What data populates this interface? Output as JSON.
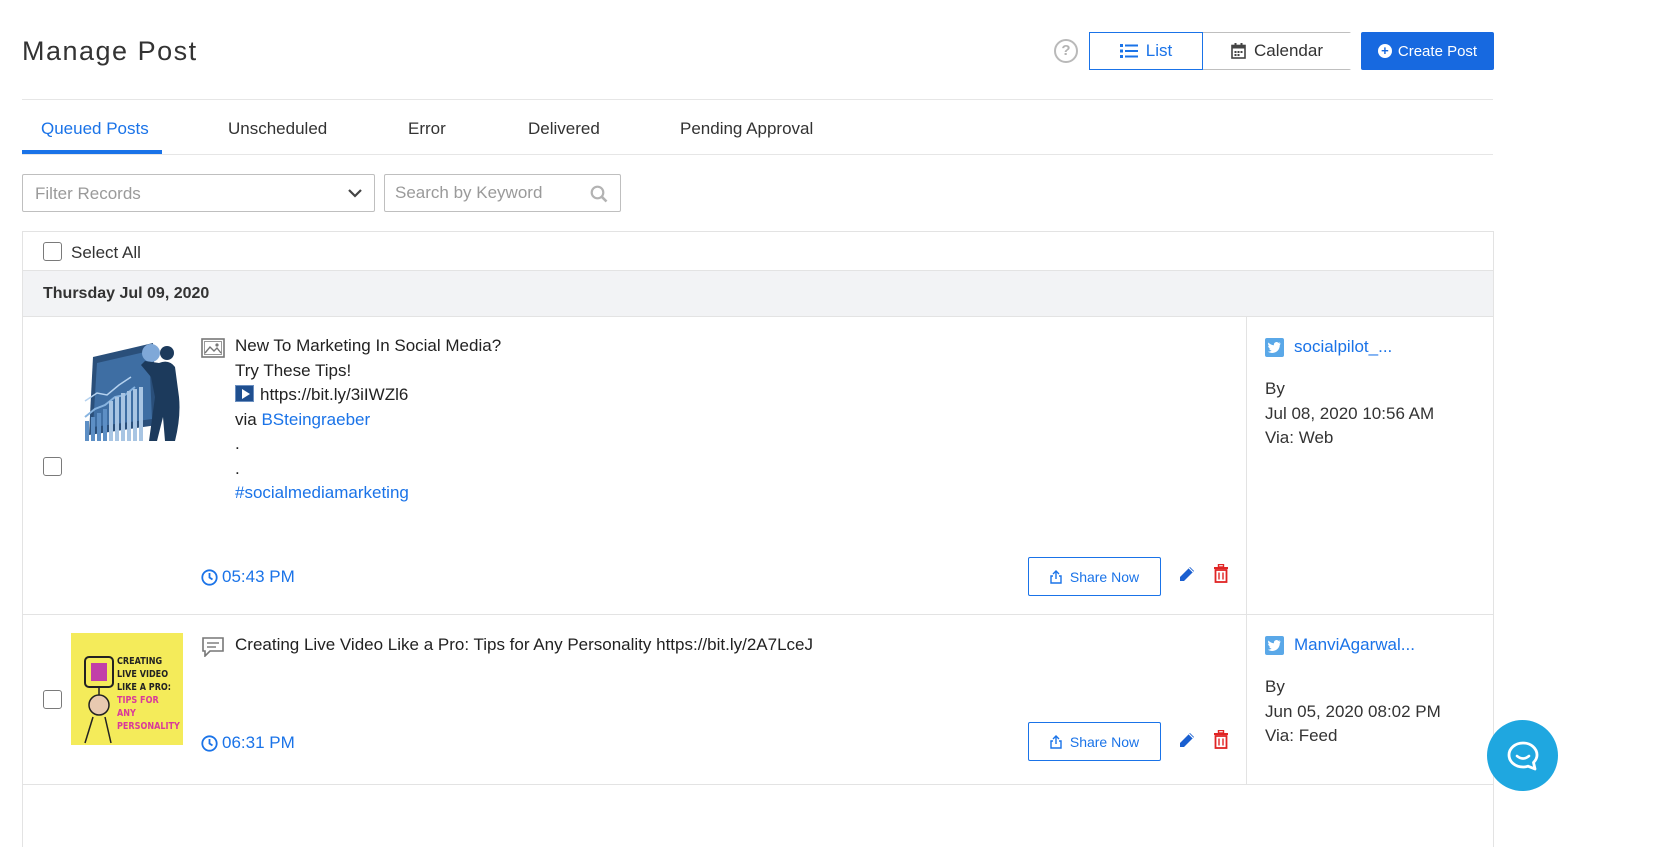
{
  "header": {
    "title": "Manage Post",
    "help_glyph": "?",
    "view_list_label": "List",
    "view_calendar_label": "Calendar",
    "create_post_label": "Create Post"
  },
  "tabs": [
    {
      "label": "Queued Posts",
      "active": true
    },
    {
      "label": "Unscheduled",
      "active": false
    },
    {
      "label": "Error",
      "active": false
    },
    {
      "label": "Delivered",
      "active": false
    },
    {
      "label": "Pending Approval",
      "active": false
    }
  ],
  "filters": {
    "filter_placeholder": "Filter Records",
    "search_placeholder": "Search by Keyword"
  },
  "table": {
    "select_all_label": "Select All",
    "date_group": "Thursday Jul 09, 2020",
    "share_label": "Share Now",
    "posts": [
      {
        "text_lines": [
          "New To Marketing In Social Media?",
          "Try These Tips!"
        ],
        "url": "https://bit.ly/3iIWZl6",
        "via_prefix": "via",
        "via_user": "BSteingraeber",
        "dots": [
          ".",
          "."
        ],
        "hashtag": "#socialmediamarketing",
        "time": "05:43 PM",
        "account": "socialpilot_...",
        "by_label": "By",
        "created": "Jul 08, 2020 10:56 AM",
        "via": "Via: Web",
        "content_type_icon": "image-icon"
      },
      {
        "text": "Creating Live Video Like a Pro: Tips for Any Personality https://bit.ly/2A7LceJ",
        "time": "06:31 PM",
        "account": "ManviAgarwal...",
        "by_label": "By",
        "created": "Jun 05, 2020 08:02 PM",
        "via": "Via: Feed",
        "content_type_icon": "text-post-icon",
        "thumb_text": [
          "CREATING",
          "LIVE VIDEO",
          "LIKE A PRO:",
          "TIPS FOR ANY",
          "PERSONALITY"
        ]
      }
    ]
  },
  "colors": {
    "accent": "#1a73e8",
    "danger": "#e02424",
    "twitter": "#5aa8e8",
    "chat": "#1fa7e0"
  }
}
